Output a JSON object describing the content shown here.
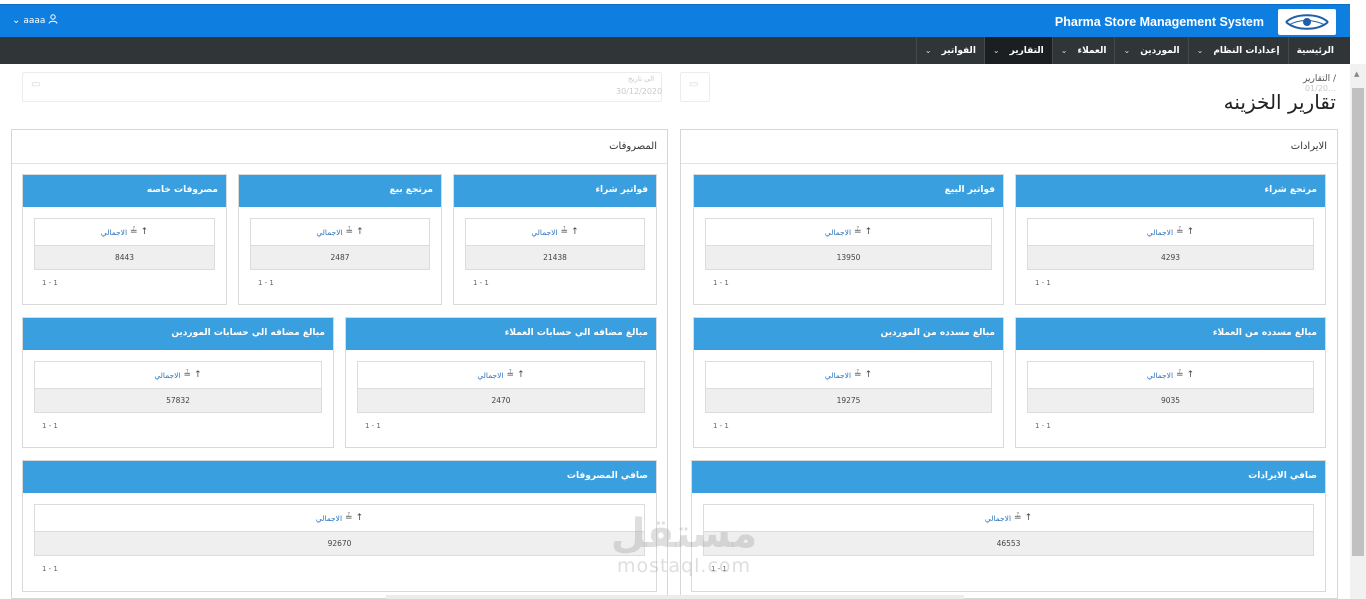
{
  "header": {
    "user_label": "aaaa",
    "app_title": "Pharma Store Management System",
    "accent_color": "#0e7fe1"
  },
  "nav": {
    "items": [
      {
        "label": "الرئيسية",
        "has_dropdown": false,
        "active": false
      },
      {
        "label": "إعدادات النظام",
        "has_dropdown": true,
        "active": false
      },
      {
        "label": "الموردين",
        "has_dropdown": true,
        "active": false
      },
      {
        "label": "العملاء",
        "has_dropdown": true,
        "active": false
      },
      {
        "label": "التقارير",
        "has_dropdown": true,
        "active": true
      },
      {
        "label": "الفواتير",
        "has_dropdown": true,
        "active": false
      }
    ]
  },
  "breadcrumb": "التقارير /",
  "filters": {
    "from_date_faded": "01/20…",
    "to_label_faded": "الى تاريخ",
    "to_date_faded": "30/12/2020"
  },
  "page_title": "تقارير الخزينه",
  "revenues": {
    "title": "الايرادات",
    "cards": [
      {
        "title": "مرتجع شراء",
        "column_label": "الاجمالي",
        "value": "4293",
        "pager": "1 - 1"
      },
      {
        "title": "فواتير البيع",
        "column_label": "الاجمالي",
        "value": "13950",
        "pager": "1 - 1"
      },
      {
        "title": "مبالغ مسدده من العملاء",
        "column_label": "الاجمالي",
        "value": "9035",
        "pager": "1 - 1"
      },
      {
        "title": "مبالغ مسدده من الموردين",
        "column_label": "الاجمالي",
        "value": "19275",
        "pager": "1 - 1"
      },
      {
        "title": "صافي الايرادات",
        "column_label": "الاجمالي",
        "value": "46553",
        "pager": "1 - 1"
      }
    ]
  },
  "expenses": {
    "title": "المصروفات",
    "cards": [
      {
        "title": "فواتير شراء",
        "column_label": "الاجمالي",
        "value": "21438",
        "pager": "1 - 1"
      },
      {
        "title": "مرتجع بيع",
        "column_label": "الاجمالي",
        "value": "2487",
        "pager": "1 - 1"
      },
      {
        "title": "مصروفات خاصه",
        "column_label": "الاجمالي",
        "value": "8443",
        "pager": "1 - 1"
      },
      {
        "title": "مبالغ مضافه الي حسابات العملاء",
        "column_label": "الاجمالي",
        "value": "2470",
        "pager": "1 - 1"
      },
      {
        "title": "مبالغ مضافه الي حسابات الموردين",
        "column_label": "الاجمالي",
        "value": "57832",
        "pager": "1 - 1"
      },
      {
        "title": "صافي المصروفات",
        "column_label": "الاجمالي",
        "value": "92670",
        "pager": "1 - 1"
      }
    ]
  },
  "watermark": {
    "arabic": "مستقل",
    "latin": "mostaql.com"
  }
}
